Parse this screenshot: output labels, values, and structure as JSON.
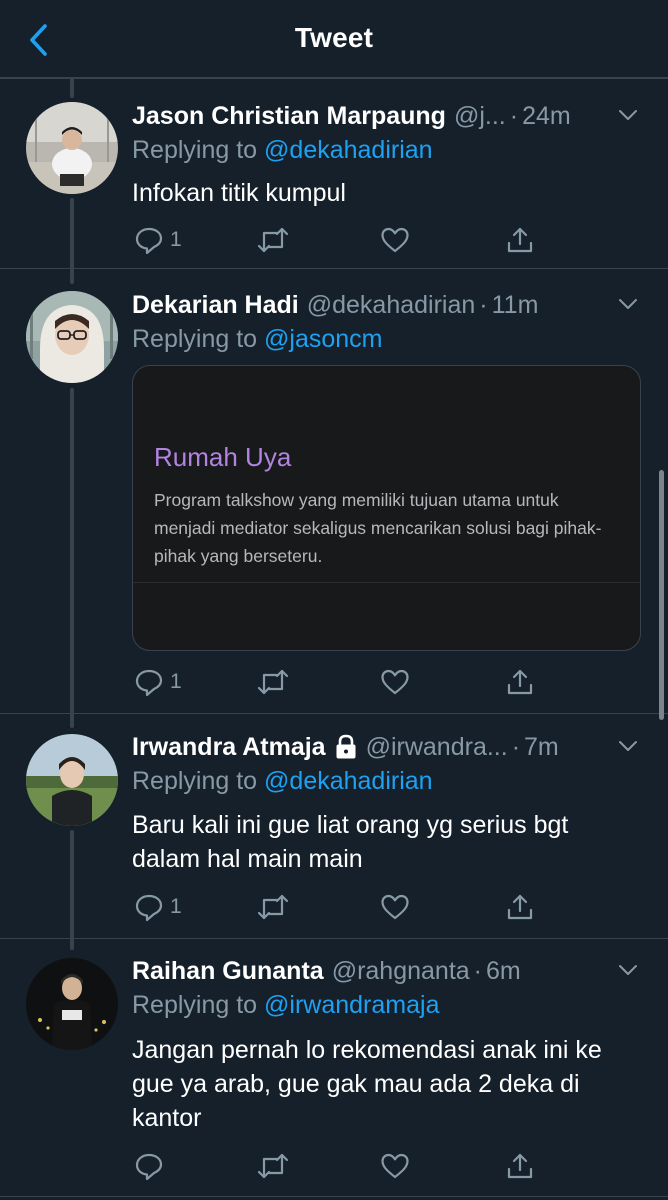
{
  "header": {
    "title": "Tweet"
  },
  "tweets": [
    {
      "name": "Jason Christian Marpaung",
      "handle": "@j...",
      "time": "24m",
      "replying_prefix": "Replying to",
      "replying_to": "@dekahadirian",
      "text": "Infokan titik kumpul",
      "reply_count": "1",
      "retweet_count": "",
      "like_count": ""
    },
    {
      "name": "Dekarian Hadi",
      "handle": "@dekahadirian",
      "time": "11m",
      "replying_prefix": "Replying to",
      "replying_to": "@jasoncm",
      "card": {
        "title": "Rumah Uya",
        "description": "Program talkshow yang memiliki tujuan utama untuk menjadi mediator sekaligus mencarikan solusi bagi pihak-pihak yang berseteru."
      },
      "reply_count": "1",
      "retweet_count": "",
      "like_count": ""
    },
    {
      "name": "Irwandra Atmaja",
      "handle": "@irwandra...",
      "time": "7m",
      "protected": true,
      "replying_prefix": "Replying to",
      "replying_to": "@dekahadirian",
      "text": "Baru kali ini gue liat orang yg serius bgt dalam hal main main",
      "reply_count": "1",
      "retweet_count": "",
      "like_count": ""
    },
    {
      "name": "Raihan Gunanta",
      "handle": "@rahgnanta",
      "time": "6m",
      "replying_prefix": "Replying to",
      "replying_to": "@irwandramaja",
      "text": "Jangan pernah lo rekomendasi anak ini ke gue ya arab, gue gak mau ada 2 deka di kantor",
      "reply_count": "",
      "retweet_count": "",
      "like_count": ""
    }
  ],
  "colors": {
    "background": "#15202b",
    "accent": "#1da1f2",
    "secondary_text": "#8899a6",
    "divider": "#38444d",
    "card_title": "#b283e0"
  },
  "icons": [
    "back-chevron-icon",
    "chevron-down-icon",
    "reply-icon",
    "retweet-icon",
    "like-heart-icon",
    "share-icon",
    "lock-icon"
  ]
}
